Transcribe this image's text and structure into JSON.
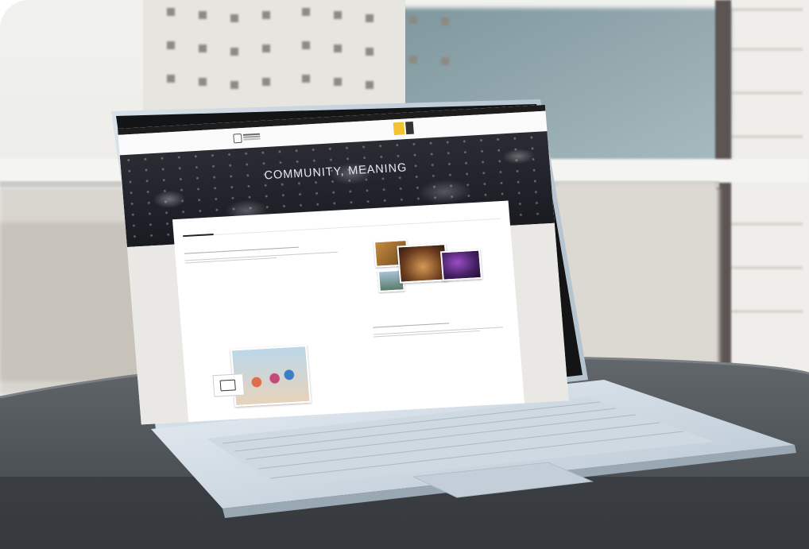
{
  "scene": {
    "description_colors": {
      "sky_wall": "#eef0ee",
      "window_glass": "#93a9ad",
      "table_top": "#55595d",
      "laptop_body": "#dde6ee",
      "screen_bezel": "#bfcad6"
    }
  },
  "website": {
    "hero_title": "COMMUNITY, MEANING",
    "hero_subtitle": "",
    "tabs": [
      "",
      "",
      ""
    ],
    "accent": "#f2c230"
  }
}
